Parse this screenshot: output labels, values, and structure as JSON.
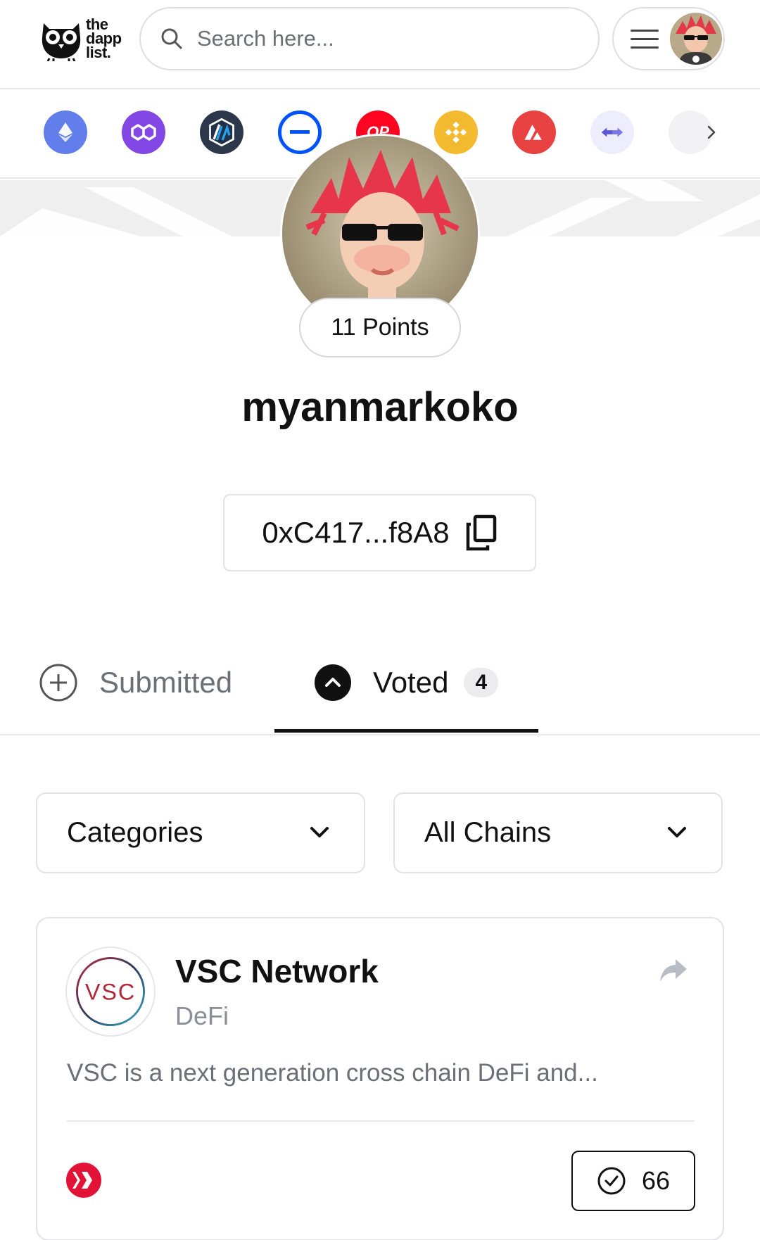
{
  "header": {
    "logo": {
      "line1": "the",
      "line2": "dapp",
      "line3": "list."
    },
    "search_placeholder": "Search here...",
    "icons": {
      "search": "search-icon",
      "menu": "hamburger-menu-icon",
      "avatar": "user-avatar"
    }
  },
  "chains": [
    {
      "name": "ethereum",
      "color": "#627eea"
    },
    {
      "name": "polygon",
      "color": "#8247e5"
    },
    {
      "name": "arbitrum",
      "color": "#2d374b"
    },
    {
      "name": "base",
      "color": "#0052ff"
    },
    {
      "name": "optimism",
      "color": "#ff0420",
      "label": "OP"
    },
    {
      "name": "bnb",
      "color": "#f3ba2f"
    },
    {
      "name": "avalanche",
      "color": "#e84142"
    },
    {
      "name": "bridge",
      "color": "#6f6ae8"
    },
    {
      "name": "more",
      "color": "#d9d9de"
    }
  ],
  "profile": {
    "points": "11 Points",
    "username": "myanmarkoko",
    "address": "0xC417...f8A8"
  },
  "tabs": {
    "submitted": "Submitted",
    "voted": "Voted",
    "voted_count": "4",
    "active": "voted"
  },
  "filters": {
    "categories": "Categories",
    "chains": "All Chains"
  },
  "card": {
    "logo_text": "VSC",
    "title": "VSC Network",
    "category": "DeFi",
    "description": "VSC is a next generation cross chain DeFi and...",
    "votes": "66",
    "chain_badge_color": "#e31337"
  }
}
